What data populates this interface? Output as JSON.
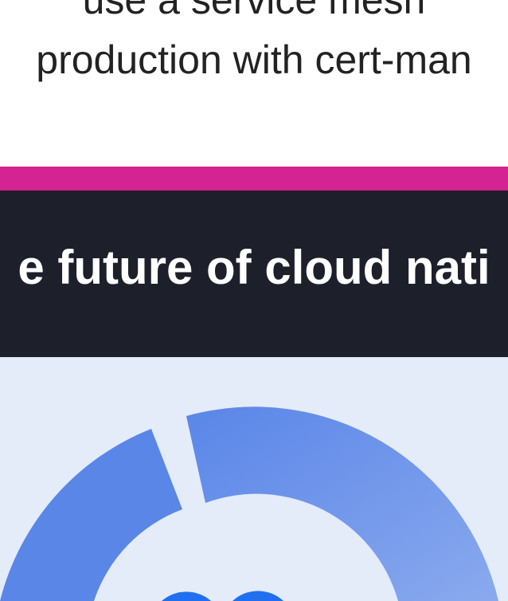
{
  "top_text": {
    "line1": "use a service mesh",
    "line2": "production with cert-man"
  },
  "banner": {
    "headline": "e future of cloud nati"
  },
  "colors": {
    "accent": "#d42392",
    "dark_bg": "#1d1f2b",
    "art_bg": "#e3ecf8",
    "ring_dark": "#5a86e8",
    "ring_light": "#8aa9ee",
    "core_blue": "#1f6ff0"
  },
  "illustration": {
    "icon": "donut-ring-icon"
  }
}
